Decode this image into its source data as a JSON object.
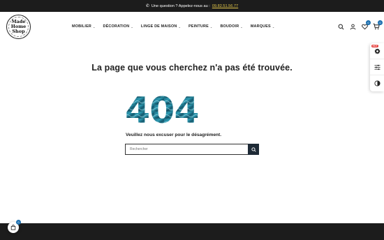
{
  "topbar": {
    "question": "Une question ? Appelez-nous au :",
    "phone": "09.82.51.56.77"
  },
  "logo": {
    "line1": "Made",
    "line2": "Home",
    "line3": "Shop"
  },
  "nav": [
    {
      "label": "MOBILIER"
    },
    {
      "label": "DÉCORATION"
    },
    {
      "label": "LINGE DE MAISON"
    },
    {
      "label": "PEINTURE"
    },
    {
      "label": "BOUDOIR"
    },
    {
      "label": "MARQUES"
    }
  ],
  "header_icons": {
    "wishlist_count": "0",
    "cart_count": "0"
  },
  "side_tools": {
    "hot_label": "HOT"
  },
  "main": {
    "title": "La page que vous cherchez n'a pas été trouvée.",
    "code": "404",
    "apology": "Veuillez nous excuser pour le désagrément.",
    "search_placeholder": "Rechercher"
  },
  "floating_cart": {
    "count": "0"
  },
  "colors": {
    "dark": "#1c1c1c",
    "accent_yellow": "#e4c84a",
    "badge_blue": "#1b6fb0",
    "teal": "#1f6f86"
  }
}
